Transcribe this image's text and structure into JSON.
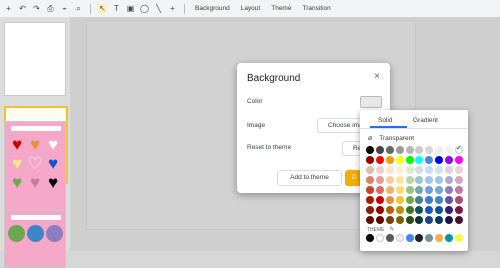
{
  "toolbar": {
    "icons": [
      "plus-icon",
      "undo-icon",
      "redo-icon",
      "print-icon",
      "paint-format-icon",
      "zoom-icon",
      "select-icon",
      "textbox-icon",
      "image-icon",
      "shape-icon",
      "line-icon",
      "add-icon"
    ],
    "menus": [
      "Background",
      "Layout",
      "Theme",
      "Transition"
    ]
  },
  "dialog": {
    "title": "Background",
    "close": "×",
    "color_label": "Color",
    "image_label": "Image",
    "choose_image": "Choose ima",
    "reset_label": "Reset to theme",
    "reset_button": "Re",
    "add_to_theme": "Add to theme",
    "done": "D"
  },
  "picker": {
    "tab_solid": "Solid",
    "tab_gradient": "Gradient",
    "transparent": "Transparent",
    "theme_label": "THEME",
    "check": "✓",
    "rows": [
      [
        "#000000",
        "#434343",
        "#666666",
        "#999999",
        "#b7b7b7",
        "#cccccc",
        "#d9d9d9",
        "#efefef",
        "#f3f3f3",
        "#ffffff"
      ],
      [
        "#980000",
        "#ff0000",
        "#ff9900",
        "#ffff00",
        "#00ff00",
        "#00ffff",
        "#4a86e8",
        "#0000ff",
        "#9900ff",
        "#ff00ff"
      ],
      [
        "#e6b8af",
        "#f4cccc",
        "#fce5cd",
        "#fff2cc",
        "#d9ead3",
        "#d0e0e3",
        "#c9daf8",
        "#cfe2f3",
        "#d9d2e9",
        "#ead1dc"
      ],
      [
        "#dd7e6b",
        "#ea9999",
        "#f9cb9c",
        "#ffe599",
        "#b6d7a8",
        "#a2c4c9",
        "#a4c2f4",
        "#9fc5e8",
        "#b4a7d6",
        "#d5a6bd"
      ],
      [
        "#cc4125",
        "#e06666",
        "#f6b26b",
        "#ffd966",
        "#93c47d",
        "#76a5af",
        "#6d9eeb",
        "#6fa8dc",
        "#8e7cc3",
        "#c27ba0"
      ],
      [
        "#a61c00",
        "#cc0000",
        "#e69138",
        "#f1c232",
        "#6aa84f",
        "#45818e",
        "#3c78d8",
        "#3d85c6",
        "#674ea7",
        "#a64d79"
      ],
      [
        "#85200c",
        "#990000",
        "#b45f06",
        "#bf9000",
        "#38761d",
        "#134f5c",
        "#1155cc",
        "#0b5394",
        "#351c75",
        "#741b47"
      ],
      [
        "#5b0f00",
        "#660000",
        "#783f04",
        "#7f6000",
        "#274e13",
        "#0c343d",
        "#1c4587",
        "#073763",
        "#20124d",
        "#4c1130"
      ]
    ],
    "theme_colors": [
      "#000000",
      "#ffffff",
      "#595959",
      "#eeeeee",
      "#4285f4",
      "#212121",
      "#78909c",
      "#ffab40",
      "#0097a7",
      "#eeff41"
    ]
  }
}
